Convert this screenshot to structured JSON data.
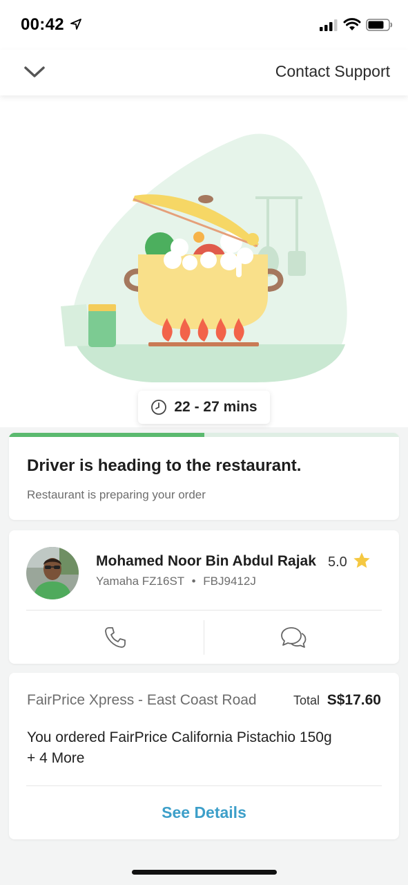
{
  "status_bar": {
    "time": "00:42",
    "icons": [
      "location-arrow-icon",
      "cellular-signal-icon",
      "wifi-icon",
      "battery-icon"
    ]
  },
  "header": {
    "back_icon": "chevron-down-icon",
    "contact_support": "Contact Support"
  },
  "hero": {
    "illustration": "cooking-pot-illustration",
    "eta_icon": "clock-icon",
    "eta": "22 - 27 mins"
  },
  "status_card": {
    "progress_fraction": 0.5,
    "title": "Driver is heading to the restaurant.",
    "subtitle": "Restaurant is preparing your order"
  },
  "driver_card": {
    "name": "Mohamed Noor Bin Abdul Rajak",
    "rating": "5.0",
    "rating_icon": "star-icon",
    "vehicle": "Yamaha FZ16ST",
    "separator": "•",
    "plate": "FBJ9412J",
    "actions": [
      "phone-icon",
      "chat-bubbles-icon"
    ]
  },
  "order_card": {
    "store": "FairPrice Xpress - East Coast Road",
    "total_label": "Total",
    "total_value": "S$17.60",
    "order_text": "You ordered FairPrice California Pistachio 150g",
    "more_text": "+ 4 More",
    "see_details": "See Details"
  },
  "colors": {
    "accent_green": "#5bba6f",
    "link_blue": "#3d9fc9",
    "star_yellow": "#f5c842",
    "illustration_bg": "#e6f4ea"
  }
}
